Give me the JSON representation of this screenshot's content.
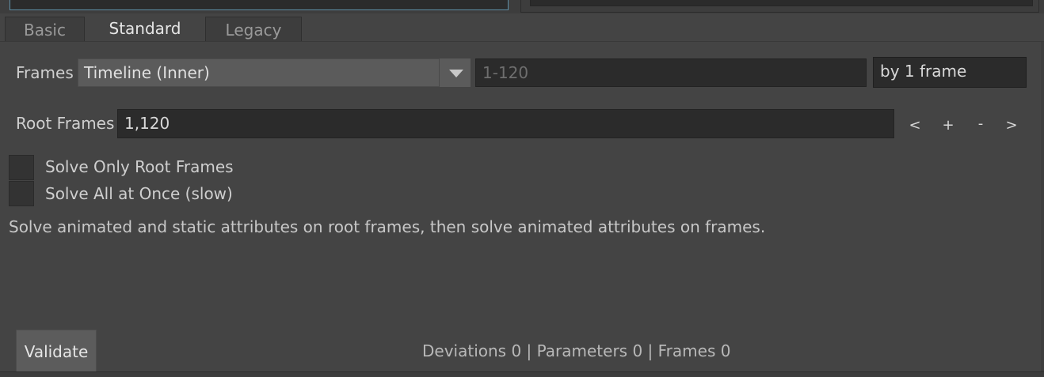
{
  "tabs": [
    {
      "label": "Basic",
      "active": false
    },
    {
      "label": "Standard",
      "active": true
    },
    {
      "label": "Legacy",
      "active": false
    }
  ],
  "frames": {
    "label": "Frames",
    "mode_value": "Timeline (Inner)",
    "range_value": "1-120",
    "step_value": "by 1 frame"
  },
  "root_frames": {
    "label": "Root Frames",
    "value": "1,120",
    "nav": {
      "prev": "<",
      "add": "+",
      "remove": "-",
      "next": ">"
    }
  },
  "options": {
    "solve_only_root": {
      "label": "Solve Only Root Frames",
      "checked": false
    },
    "solve_all_once": {
      "label": "Solve All at Once (slow)",
      "checked": false
    }
  },
  "description": "Solve animated and static attributes on root frames, then solve animated attributes on frames.",
  "footer": {
    "validate_label": "Validate",
    "status": "Deviations 0 | Parameters 0 | Frames 0"
  },
  "colors": {
    "background": "#444444",
    "field": "#2b2b2b",
    "combo": "#5b5b5b",
    "focus_border": "#5f8fa6"
  }
}
